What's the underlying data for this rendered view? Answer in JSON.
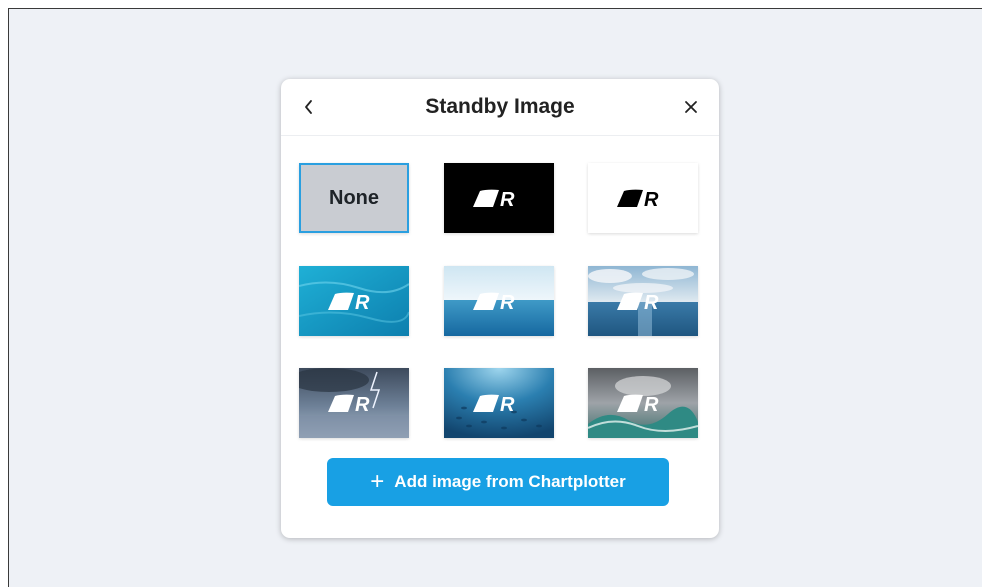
{
  "dialog": {
    "title": "Standby Image",
    "back_icon": "chevron-left-icon",
    "close_icon": "close-icon"
  },
  "images": [
    {
      "label": "None",
      "style": "none",
      "selected": true
    },
    {
      "label": "",
      "style": "logo-black-bg"
    },
    {
      "label": "",
      "style": "logo-white-bg"
    },
    {
      "label": "",
      "style": "ocean-turquoise"
    },
    {
      "label": "",
      "style": "ocean-horizon-calm"
    },
    {
      "label": "",
      "style": "ocean-horizon-clouds"
    },
    {
      "label": "",
      "style": "storm-lightning"
    },
    {
      "label": "",
      "style": "underwater-fish"
    },
    {
      "label": "",
      "style": "stormy-waves"
    }
  ],
  "add_button": {
    "icon": "plus-icon",
    "label": "Add image from Chartplotter"
  },
  "colors": {
    "accent": "#18a0e4",
    "selected_border": "#2a9fe0",
    "none_bg": "#c9ccd2"
  }
}
